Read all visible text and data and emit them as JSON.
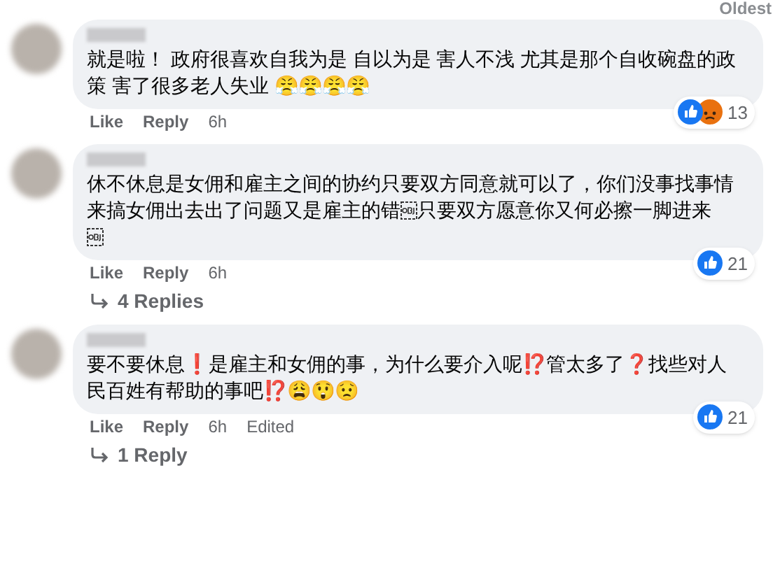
{
  "sort_label": "Oldest",
  "comments": [
    {
      "parts": [
        {
          "kind": "text",
          "text": "就是啦！ 政府很喜欢自我为是 自以为是 害人不浅 尤其是那个自收碗盘的政策 害了很多老人失业 😤😤😤😤"
        }
      ],
      "reactions": [
        {
          "kind": "like"
        },
        {
          "kind": "angry"
        }
      ],
      "reaction_count": "13",
      "like": "Like",
      "reply": "Reply",
      "time": "6h"
    },
    {
      "parts": [
        {
          "kind": "text",
          "text": "休不休息是女佣和雇主之间的协约只要双方同意就可以了，你们没事找事情来搞女佣出去出了问题又是雇主的错"
        },
        {
          "kind": "object"
        },
        {
          "kind": "text",
          "text": "只要双方愿意你又何必擦一脚进来"
        },
        {
          "kind": "break"
        },
        {
          "kind": "object"
        }
      ],
      "reactions": [
        {
          "kind": "like"
        }
      ],
      "reaction_count": "21",
      "like": "Like",
      "reply": "Reply",
      "time": "6h",
      "replies_link": "4 Replies"
    },
    {
      "parts": [
        {
          "kind": "text",
          "text": "要不要休息❗是雇主和女佣的事，为什么要介入呢⁉️管太多了❓找些对人民百姓有帮助的事吧⁉️😩😲😟"
        }
      ],
      "reactions": [
        {
          "kind": "like"
        }
      ],
      "reaction_count": "21",
      "like": "Like",
      "reply": "Reply",
      "time": "6h",
      "edited": "Edited",
      "replies_link": "1 Reply"
    }
  ]
}
